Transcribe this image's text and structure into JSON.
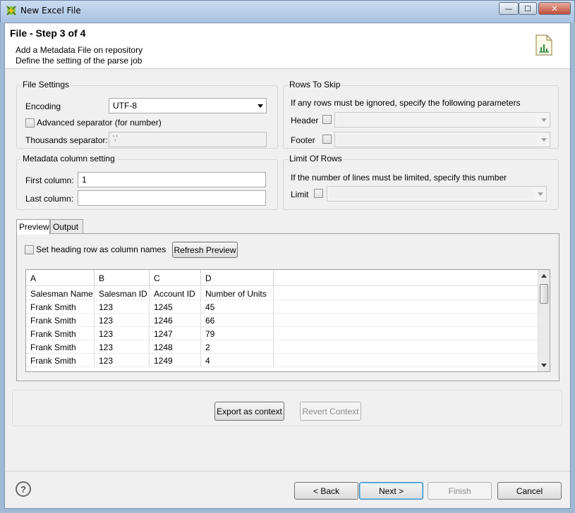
{
  "window": {
    "title": "New Excel File",
    "min_label": "—",
    "max_label": "☐",
    "close_label": "✕"
  },
  "header": {
    "step_title": "File - Step 3 of 4",
    "line1": "Add a Metadata File on repository",
    "line2": "Define the setting of the parse job"
  },
  "file_settings": {
    "title": "File Settings",
    "encoding_label": "Encoding",
    "encoding_value": "UTF-8",
    "advanced_label": "Advanced separator (for number)",
    "advanced_checked": false,
    "thousands_label": "Thousands separator:",
    "thousands_value": "','"
  },
  "rows_to_skip": {
    "title": "Rows To Skip",
    "hint": "If any rows must be ignored, specify the following parameters",
    "header_label": "Header",
    "footer_label": "Footer"
  },
  "metadata_columns": {
    "title": "Metadata column setting",
    "first_label": "First column:",
    "first_value": "1",
    "last_label": "Last column:",
    "last_value": ""
  },
  "limit_rows": {
    "title": "Limit Of Rows",
    "hint": "If the number of lines must be limited, specify this number",
    "limit_label": "Limit"
  },
  "tabs": {
    "preview": "Preview",
    "output": "Output"
  },
  "preview": {
    "heading_checkbox_label": "Set heading row as column names",
    "refresh_button": "Refresh Preview",
    "columns": [
      "A",
      "B",
      "C",
      "D"
    ],
    "rows": [
      [
        "Salesman Name",
        "Salesman ID",
        "Account ID",
        "Number of Units"
      ],
      [
        "Frank Smith",
        "123",
        "1245",
        "45"
      ],
      [
        "Frank Smith",
        "123",
        "1246",
        "66"
      ],
      [
        "Frank Smith",
        "123",
        "1247",
        "79"
      ],
      [
        "Frank Smith",
        "123",
        "1248",
        "2"
      ],
      [
        "Frank Smith",
        "123",
        "1249",
        "4"
      ]
    ]
  },
  "context": {
    "export_button": "Export as context",
    "revert_button": "Revert Context"
  },
  "footer": {
    "help": "?",
    "back": "< Back",
    "next": "Next >",
    "finish": "Finish",
    "cancel": "Cancel"
  }
}
